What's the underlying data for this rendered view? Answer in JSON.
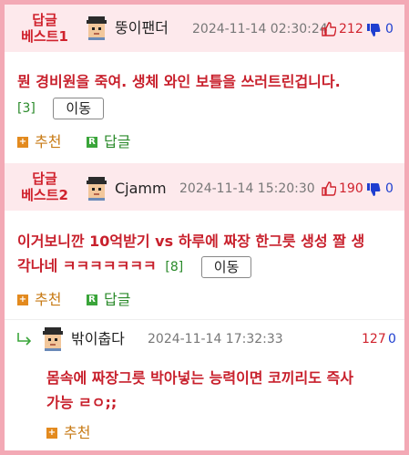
{
  "best_comments": [
    {
      "label_line1": "답글",
      "label_line2": "베스트1",
      "nickname": "뚱이팬더",
      "datetime": "2024-11-14 02:30:24",
      "up_count": "212",
      "down_count": "0",
      "content": "뭔 경비원을 죽여. 생체 와인 보틀을 쓰러트린겁니다.",
      "reply_count": "[3]",
      "move_label": "이동",
      "recommend_label": "추천",
      "reply_label": "답글"
    },
    {
      "label_line1": "답글",
      "label_line2": "베스트2",
      "nickname": "Cjamm",
      "datetime": "2024-11-14 15:20:30",
      "up_count": "190",
      "down_count": "0",
      "content_line1": "이거보니깐 10억받기 vs 하루에 짜장 한그릇 생성 짤 생",
      "content_line2": "각나네 ㅋㅋㅋㅋㅋㅋㅋ",
      "reply_count": "[8]",
      "move_label": "이동",
      "recommend_label": "추천",
      "reply_label": "답글"
    }
  ],
  "reply": {
    "nickname": "밖이춥다",
    "datetime": "2024-11-14 17:32:33",
    "up_count": "127",
    "down_count": "0",
    "content_line1": "몸속에 짜장그릇 박아넣는 능력이면 코끼리도 즉사",
    "content_line2": "가능 ㄹㅇ;;",
    "recommend_label": "추천"
  },
  "icons": {
    "thumb_up": "thumb-up-icon",
    "thumb_down": "thumb-down-icon",
    "plus": "plus-box-icon",
    "reply_r": "r-box-icon",
    "reply_arrow": "reply-arrow-icon"
  },
  "colors": {
    "accent_red": "#d0222d",
    "down_blue": "#1f3fd0",
    "green": "#2a8a2a",
    "orange": "#e38a1e",
    "header_bg": "#fde9ec",
    "border_pink": "#f3a9b5"
  }
}
